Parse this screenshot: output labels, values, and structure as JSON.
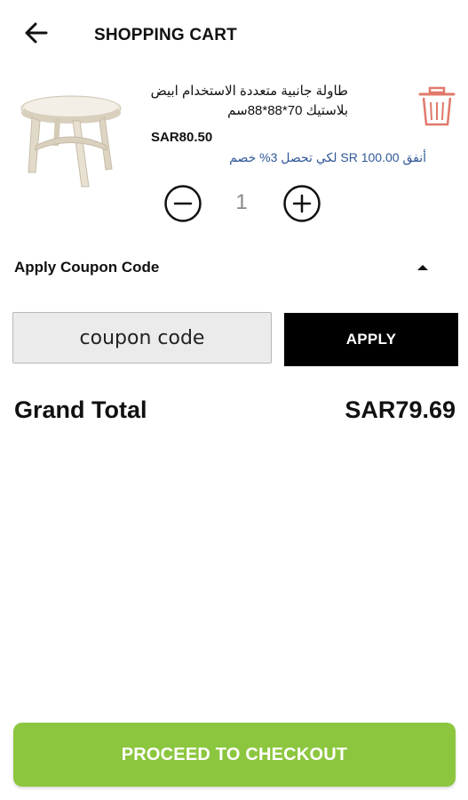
{
  "header": {
    "title": "SHOPPING CART",
    "back_icon": "arrow-left-icon"
  },
  "cart": {
    "items": [
      {
        "name": "طاولة جانبية  متعددة الاستخدام ابيض بلاستيك 70*88*88سم",
        "price": "SAR80.50",
        "promo": "أنفق SR 100.00 لكي تحصل  3% خصم",
        "quantity": "1",
        "image_icon": "round-table-image",
        "remove_icon": "trash-icon"
      }
    ]
  },
  "coupon": {
    "header": "Apply Coupon Code",
    "toggle_icon": "caret-up-icon",
    "placeholder": "coupon code",
    "apply_label": "APPLY"
  },
  "summary": {
    "grand_total_label": "Grand Total",
    "grand_total_value": "SAR79.69"
  },
  "checkout": {
    "label": "PROCEED TO CHECKOUT"
  },
  "colors": {
    "accent": "#8cc63f",
    "trash": "#e0796a",
    "promo_text": "#2f5796",
    "apply_bg": "#000000"
  }
}
